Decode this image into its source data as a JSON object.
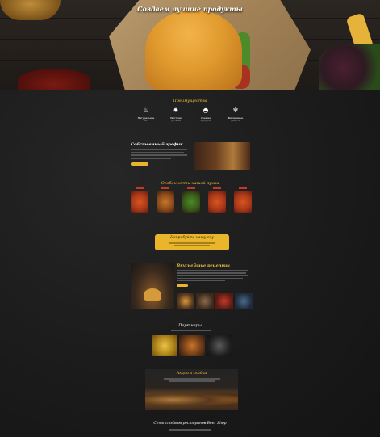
{
  "hero": {
    "title": "Создаем лучшие продукты"
  },
  "advantages": {
    "title": "Преимущества",
    "items": [
      {
        "icon": "chef-icon",
        "label": "Натуральное",
        "sub": "мясо"
      },
      {
        "icon": "star-icon",
        "label": "Быстрая",
        "sub": "доставка"
      },
      {
        "icon": "burger-icon",
        "label": "Свежие",
        "sub": "продукты"
      },
      {
        "icon": "gear-icon",
        "label": "Фирменные",
        "sub": "рецепты"
      }
    ]
  },
  "schedule": {
    "title": "Собственный график",
    "button_label": ""
  },
  "specialties": {
    "title": "Особенности нашей кухни",
    "dishes": [
      {
        "caption": ""
      },
      {
        "caption": ""
      },
      {
        "caption": ""
      },
      {
        "caption": ""
      },
      {
        "caption": ""
      }
    ]
  },
  "order": {
    "title": "Попробуйте нашу еду",
    "subtitle": ""
  },
  "burgers": {
    "title": "Вкуснейшие рецепты",
    "thumbs": [
      {
        "label": ""
      },
      {
        "label": ""
      },
      {
        "label": ""
      },
      {
        "label": ""
      }
    ]
  },
  "partners": {
    "title": "Партнеры"
  },
  "promo": {
    "title": "Акции и скидки"
  },
  "footer": {
    "title": "Сеть стейков ресторанов Beer Shop"
  },
  "colors": {
    "accent": "#e9b52c",
    "background": "#1c1c1c",
    "title_gold": "#f0c040",
    "badge_red": "#c0392b"
  }
}
